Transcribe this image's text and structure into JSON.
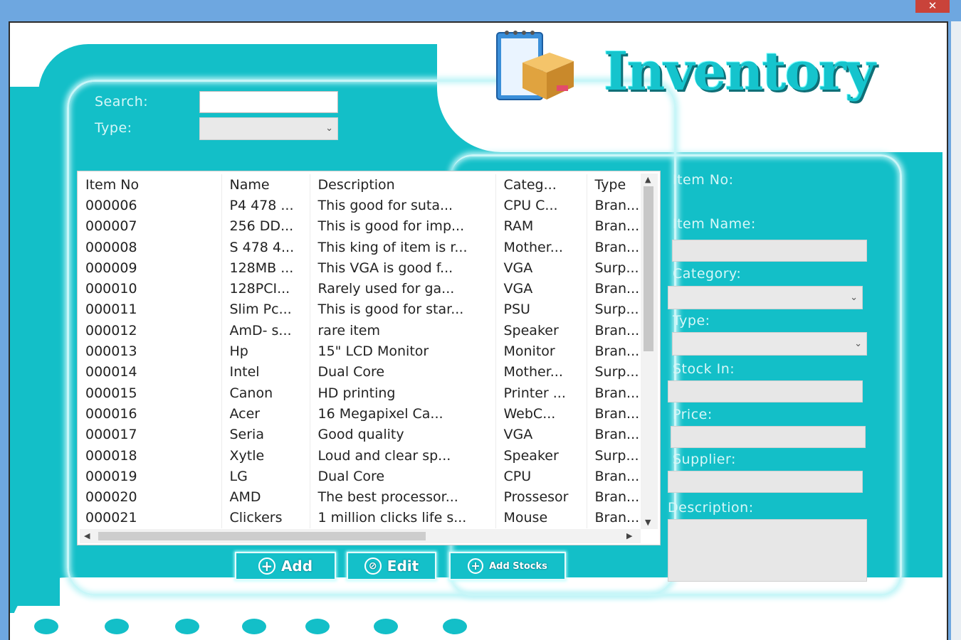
{
  "window": {
    "close_glyph": "✕"
  },
  "header": {
    "title": "Inventory",
    "logo_icon": "calendar-box-icon"
  },
  "filters": {
    "search_label": "Search:",
    "search_value": "",
    "type_label": "Type:",
    "type_value": ""
  },
  "table": {
    "columns": [
      "Item No",
      "Name",
      "Description",
      "Categ...",
      "Type"
    ],
    "rows": [
      [
        "000006",
        "P4 478 ...",
        "This good for suta...",
        "CPU C...",
        "Bran..."
      ],
      [
        "000007",
        "256 DD...",
        "This is good for imp...",
        "RAM",
        "Bran..."
      ],
      [
        "000008",
        "S 478 4...",
        "This king of item is r...",
        "Mother...",
        "Bran..."
      ],
      [
        "000009",
        "128MB ...",
        "This VGA is good f...",
        "VGA",
        "Surp..."
      ],
      [
        "000010",
        "128PCI...",
        "Rarely used for ga...",
        "VGA",
        "Bran..."
      ],
      [
        "000011",
        "Slim Pc...",
        "This is good for star...",
        "PSU",
        "Surp..."
      ],
      [
        "000012",
        "AmD- s...",
        "rare item",
        "Speaker",
        "Bran..."
      ],
      [
        "000013",
        "Hp",
        "15\" LCD Monitor",
        "Monitor",
        "Bran..."
      ],
      [
        "000014",
        "Intel",
        "Dual Core",
        "Mother...",
        "Surp..."
      ],
      [
        "000015",
        "Canon",
        "HD printing",
        "Printer ...",
        "Bran..."
      ],
      [
        "000016",
        "Acer",
        "16 Megapixel Ca...",
        "WebC...",
        "Bran..."
      ],
      [
        "000017",
        "Seria",
        "Good quality",
        "VGA",
        "Bran..."
      ],
      [
        "000018",
        "Xytle",
        "Loud and clear sp...",
        "Speaker",
        "Surp..."
      ],
      [
        "000019",
        "LG",
        "Dual Core",
        "CPU",
        "Bran..."
      ],
      [
        "000020",
        "AMD",
        "The best processor...",
        "Prossesor",
        "Bran..."
      ],
      [
        "000021",
        "Clickers",
        "1 million clicks life s...",
        "Mouse",
        "Bran..."
      ]
    ]
  },
  "buttons": {
    "add_label": "Add",
    "edit_label": "Edit",
    "add_stocks_label": "Add Stocks"
  },
  "form": {
    "item_no_label": "Item No:",
    "item_no_value": "",
    "item_name_label": "Item Name:",
    "category_label": "Category:",
    "type_label": "Type:",
    "stock_in_label": "Stock In:",
    "price_label": "Price:",
    "supplier_label": "Supplier:",
    "description_label": "Description:"
  },
  "colors": {
    "accent": "#13bfc8",
    "titlebar": "#6ea7e0",
    "label": "#d7f7f8",
    "close": "#c9433a"
  }
}
